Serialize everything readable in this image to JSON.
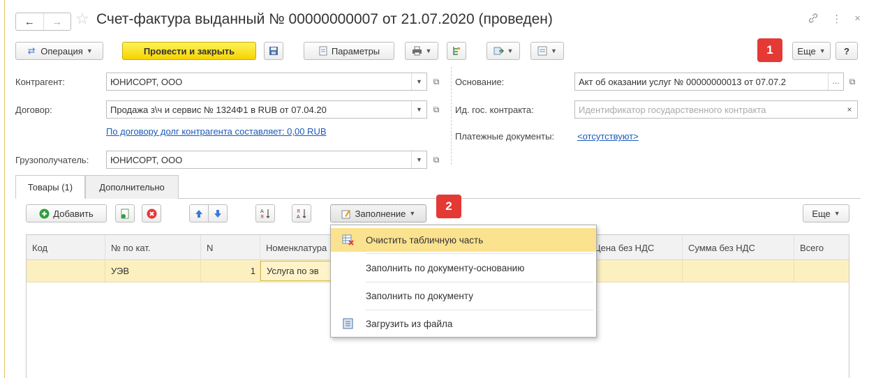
{
  "window": {
    "title": "Счет-фактура выданный № 00000000007 от 21.07.2020 (проведен)",
    "nav_back": "←",
    "nav_forward": "→",
    "star": "☆",
    "link_icon": "🔗",
    "more_icon": "⋮",
    "close_icon": "×"
  },
  "toolbar": {
    "operation_label": "Операция",
    "post_close_label": "Провести и закрыть",
    "params_label": "Параметры",
    "more_label": "Еще",
    "help_label": "?"
  },
  "badges": {
    "b1": "1",
    "b2": "2"
  },
  "form": {
    "counterparty_label": "Контрагент:",
    "counterparty_value": "ЮНИСОРТ, ООО",
    "contract_label": "Договор:",
    "contract_value": "Продажа з\\ч и сервис № 1324Ф1 в RUB от 07.04.20",
    "debt_link": "По договору долг контрагента составляет: 0,00 RUB",
    "consignee_label": "Грузополучатель:",
    "consignee_value": "ЮНИСОРТ, ООО",
    "basis_label": "Основание:",
    "basis_value": "Акт об оказании услуг № 00000000013 от 07.07.2",
    "gov_contract_label": "Ид. гос. контракта:",
    "gov_contract_placeholder": "Идентификатор государственного контракта",
    "payment_docs_label": "Платежные документы:",
    "payment_docs_link": "<отсутствуют>"
  },
  "tabs": [
    {
      "label": "Товары (1)"
    },
    {
      "label": "Дополнительно"
    }
  ],
  "table_toolbar": {
    "add_label": "Добавить",
    "fill_label": "Заполнение",
    "more_label": "Еще"
  },
  "table": {
    "columns": [
      "Код",
      "№ по кат.",
      "N",
      "Номенклатура",
      "Цена без НДС",
      "Сумма без НДС",
      "Всего"
    ],
    "rows": [
      {
        "code": "",
        "cat": "УЭВ",
        "n": "1",
        "item": "Услуга по эв",
        "price": "",
        "sum": "",
        "total": ""
      }
    ]
  },
  "fill_menu": {
    "items": [
      {
        "label": "Очистить табличную часть",
        "icon": "clear-table-icon"
      },
      {
        "label": "Заполнить по документу-основанию",
        "icon": ""
      },
      {
        "label": "Заполнить по документу",
        "icon": ""
      },
      {
        "label": "Загрузить из файла",
        "icon": "load-file-icon"
      }
    ]
  },
  "colors": {
    "primary_button": "#f7d400",
    "badge": "#e53935",
    "link": "#1a5ab8",
    "row_highlight": "#fdf0c0",
    "menu_highlight": "#fbe28f"
  }
}
